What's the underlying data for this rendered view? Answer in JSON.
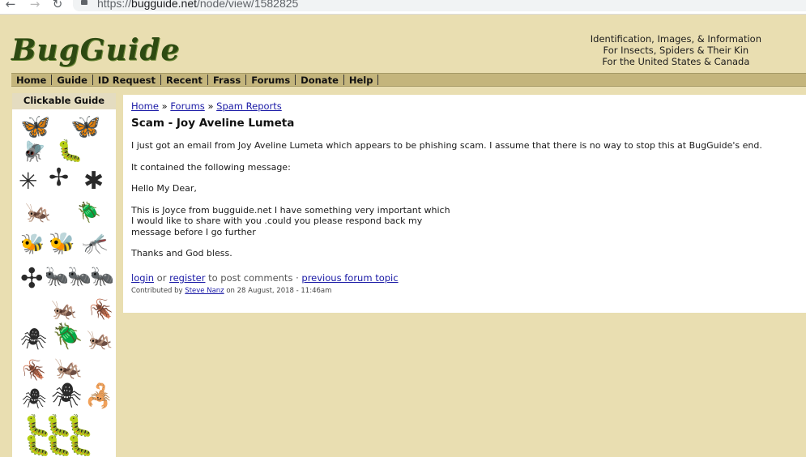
{
  "browser": {
    "url_scheme": "https://",
    "url_host": "bugguide.net",
    "url_path": "/node/view/1582825"
  },
  "header": {
    "logo_text": "BugGuide",
    "tagline": [
      "Identification, Images, & Information",
      "For Insects, Spiders & Their Kin",
      "For the United States & Canada"
    ]
  },
  "menu": [
    "Home",
    "Guide",
    "ID Request",
    "Recent",
    "Frass",
    "Forums",
    "Donate",
    "Help"
  ],
  "guide": {
    "title": "Clickable Guide"
  },
  "breadcrumb": {
    "items": [
      "Home",
      "Forums",
      "Spam Reports"
    ],
    "separator": "»"
  },
  "post": {
    "title": "Scam - Joy Aveline Lumeta",
    "paragraphs": [
      "I just got an email from Joy Aveline Lumeta which appears to be phishing scam. I assume that there is no way to stop this at BugGuide's end.",
      "It contained the following message:",
      "Hello My Dear,",
      "This is Joyce from bugguide.net I have something very important which\nI would like to share with you .could you please respond back my\nmessage before I go further",
      "Thanks and God bless."
    ]
  },
  "footer": {
    "login": "login",
    "or": "or",
    "register": "register",
    "to_post": "to post comments ·",
    "previous": "previous forum topic",
    "contributed_by": "Contributed by",
    "author": "Steve Nanz",
    "date": "on 28 August, 2018 - 11:46am"
  }
}
